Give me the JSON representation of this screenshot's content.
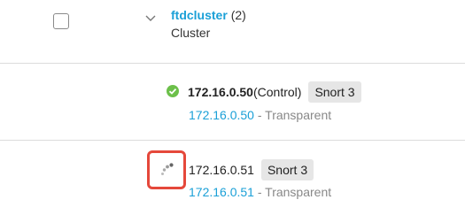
{
  "cluster": {
    "name": "ftdcluster",
    "count": "(2)",
    "type": "Cluster"
  },
  "nodes": [
    {
      "ip": "172.16.0.50",
      "role": "(Control)",
      "badge": "Snort 3",
      "link": "172.16.0.50",
      "mode": "- Transparent",
      "status_icon": "check-circle-icon",
      "status_color": "#6cc04a"
    },
    {
      "ip": "172.16.0.51",
      "badge": "Snort 3",
      "link": "172.16.0.51",
      "mode": "- Transparent",
      "status_icon": "pending-spinner-icon",
      "highlight_color": "#e5483b"
    }
  ],
  "colors": {
    "link": "#1ba0d7",
    "badge_bg": "#e6e6e6",
    "divider": "#dcdcdc"
  }
}
